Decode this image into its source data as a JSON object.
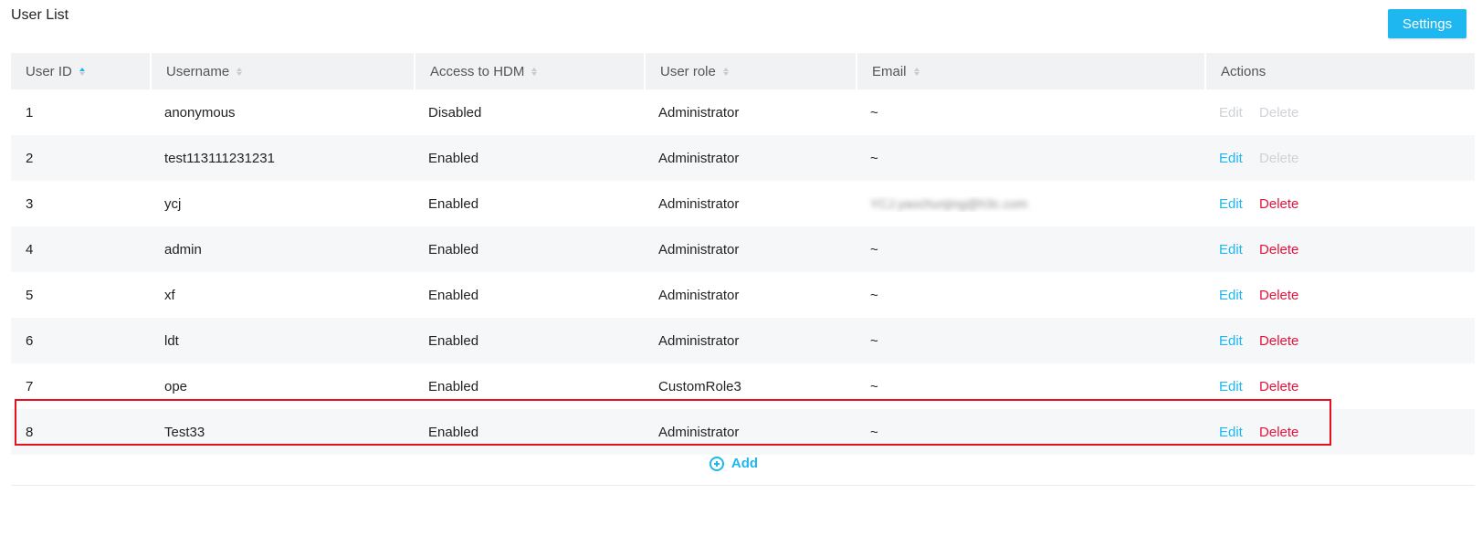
{
  "page": {
    "title": "User List",
    "settings_label": "Settings"
  },
  "table": {
    "columns": [
      {
        "label": "User ID",
        "sort": "ascending"
      },
      {
        "label": "Username",
        "sort": "none"
      },
      {
        "label": "Access to HDM",
        "sort": "none"
      },
      {
        "label": "User role",
        "sort": "none"
      },
      {
        "label": "Email",
        "sort": "none"
      },
      {
        "label": "Actions",
        "sort": null
      }
    ],
    "rows": [
      {
        "id": "1",
        "username": "anonymous",
        "hdm": "Disabled",
        "role": "Administrator",
        "email": "~",
        "edit": "Edit",
        "delete": "Delete",
        "edit_enabled": false,
        "delete_enabled": false
      },
      {
        "id": "2",
        "username": "test113111231231",
        "hdm": "Enabled",
        "role": "Administrator",
        "email": "~",
        "edit": "Edit",
        "delete": "Delete",
        "edit_enabled": true,
        "delete_enabled": false
      },
      {
        "id": "3",
        "username": "ycj",
        "hdm": "Enabled",
        "role": "Administrator",
        "email": "YCJ.yaochunjing@h3c.com",
        "email_blurred": true,
        "edit": "Edit",
        "delete": "Delete",
        "edit_enabled": true,
        "delete_enabled": true
      },
      {
        "id": "4",
        "username": "admin",
        "hdm": "Enabled",
        "role": "Administrator",
        "email": "~",
        "edit": "Edit",
        "delete": "Delete",
        "edit_enabled": true,
        "delete_enabled": true
      },
      {
        "id": "5",
        "username": "xf",
        "hdm": "Enabled",
        "role": "Administrator",
        "email": "~",
        "edit": "Edit",
        "delete": "Delete",
        "edit_enabled": true,
        "delete_enabled": true
      },
      {
        "id": "6",
        "username": "ldt",
        "hdm": "Enabled",
        "role": "Administrator",
        "email": "~",
        "edit": "Edit",
        "delete": "Delete",
        "edit_enabled": true,
        "delete_enabled": true
      },
      {
        "id": "7",
        "username": "ope",
        "hdm": "Enabled",
        "role": "CustomRole3",
        "email": "~",
        "edit": "Edit",
        "delete": "Delete",
        "edit_enabled": true,
        "delete_enabled": true
      },
      {
        "id": "8",
        "username": "Test33",
        "hdm": "Enabled",
        "role": "Administrator",
        "email": "~",
        "edit": "Edit",
        "delete": "Delete",
        "edit_enabled": true,
        "delete_enabled": true,
        "highlighted": true
      }
    ]
  },
  "footer": {
    "add_label": "Add",
    "add_icon": "plus-circle-icon"
  },
  "colors": {
    "accent": "#1fb7f0",
    "danger": "#e8123c",
    "highlight_border": "#e8101f",
    "disabled": "#cfd2d6"
  }
}
